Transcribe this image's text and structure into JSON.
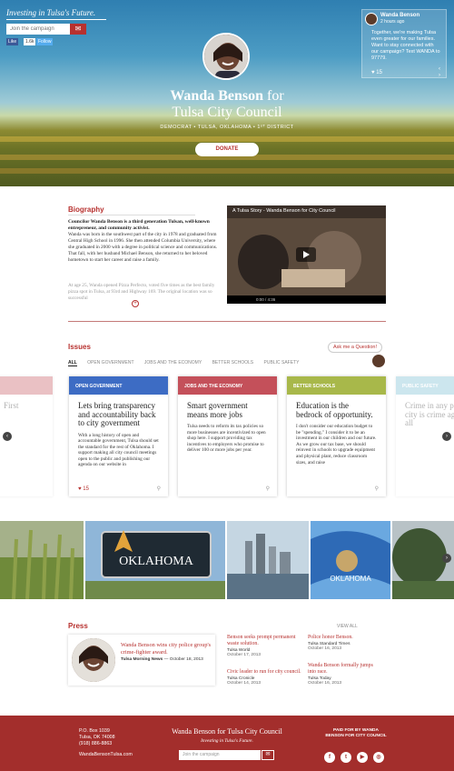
{
  "header": {
    "tagline": "Investing in Tulsa's Future.",
    "join_placeholder": "Join the campaign",
    "join_button": "✉",
    "social": [
      "Like",
      "1.6k",
      "Follow"
    ]
  },
  "tweet": {
    "name": "Wanda Benson",
    "time": "2 hours ago",
    "text": "Together, we're making Tulsa even greater for our families. Want to stay connected with our campaign? Text WANDA to 97779.",
    "hearts": "♥ 15",
    "prev": "‹",
    "next": "›"
  },
  "hero": {
    "name": "Wanda Benson",
    "name_suffix": " for",
    "office": "Tulsa City Council",
    "subtitle": "DEMOCRAT • TULSA, OKLAHOMA • 1ˢᵀ DISTRICT",
    "donate": "DONATE"
  },
  "biography": {
    "title": "Biography",
    "lead": "Councilor Wanda Benson is a third generation Tulsan, well-known entrepreneur, and community activist.",
    "text": "Wanda was born in the southwest part of the city in 1978 and graduated from Central High School in 1996. She then attended Columbia University, where she graduated in 2000 with a degree in political science and communications. That fall, with her husband Michael Benson, she returned to her beloved hometown to start her career and raise a family.",
    "text2": "At age 25, Wanda opened Pizza Perfecto, voted five times as the best family pizza spot in Tulsa, at 93rd and Highway 169. The original location was so successful",
    "more": "+"
  },
  "video": {
    "title": "A Tulsa Story - Wanda Benson for City Council",
    "time": "0:00",
    "duration": "4:36"
  },
  "issues": {
    "title": "Issues",
    "ask": "Ask me a Question!",
    "filters": [
      "ALL",
      "OPEN GOVERNMENT",
      "JOBS AND THE ECONOMY",
      "BETTER SCHOOLS",
      "PUBLIC SAFETY"
    ],
    "cards": [
      {
        "tag": "OPEN GOVERNMENT",
        "color": "#3d6cc4",
        "heading": "Lets bring transparency and accountability back to city government",
        "body": "With a long history of open and accountable government, Tulsa should set the standard for the rest of Oklahoma. I support making all city council meetings open to the public and publishing our agenda on our website in",
        "likes": "♥ 15"
      },
      {
        "tag": "JOBS AND THE ECONOMY",
        "color": "#c4505a",
        "heading": "Smart government means more jobs",
        "body": "Tulsa needs to reform its tax policies so more businesses are incentivized to open shop here. I support providing tax incentives to employers who promise to deliver 100 or more jobs per year.",
        "likes": ""
      },
      {
        "tag": "BETTER SCHOOLS",
        "color": "#a8b84a",
        "heading": "Education is the bedrock of opportunity.",
        "body": "I don't consider our education budget to be \"spending.\" I consider it to be an investment in our children and our future. As we grow our tax base, we should reinvest in schools to upgrade equipment and physical plant, reduce classroom sizes, and raise",
        "likes": ""
      }
    ],
    "ghost_left": {
      "text": "First"
    },
    "ghost_right": {
      "tag": "PUBLIC SAFETY",
      "heading": "Crime in any part of the city is crime against us all"
    }
  },
  "press": {
    "title": "Press",
    "view_all": "VIEW ALL",
    "featured": {
      "title": "Wanda Benson wins city police group's crime-fighter award.",
      "source": "Tulsa Morning News",
      "date": "October 18, 2013"
    },
    "items": [
      {
        "title": "Benson seeks prompt permanent waste solution.",
        "source": "Tulsa World",
        "date": "October 17, 2013"
      },
      {
        "title": "Civic leader to run for city council.",
        "source": "Tulsa Cronicle",
        "date": "October 14, 2013"
      },
      {
        "title": "Police honor Benson.",
        "source": "Tulsa Standard Times",
        "date": "October 16, 2013"
      },
      {
        "title": "Wanda Benson formally jumps into race.",
        "source": "Tulsa Today",
        "date": "October 16, 2013"
      }
    ]
  },
  "footer": {
    "address": [
      "P.O. Box 1039",
      "Tulsa, OK 74008",
      "(918) 886-8863"
    ],
    "url": "WandaBensonTulsa.com",
    "name": "Wanda Benson for Tulsa City Council",
    "tagline": "Investing in Tulsa's Future.",
    "join_placeholder": "Join the campaign",
    "join_button": "✉",
    "paid_by": "PAID FOR BY WANDA BENSON FOR CITY COUNCIL",
    "icons": [
      "f",
      "t",
      "▶",
      "◎"
    ]
  },
  "photos": {
    "sign_text": "OKLAHOMA",
    "flag_text": "OKLAHOMA"
  }
}
